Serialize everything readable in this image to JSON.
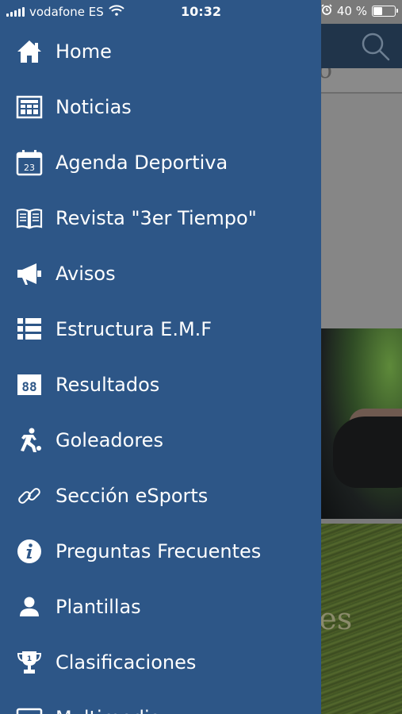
{
  "status_bar": {
    "carrier": "vodafone ES",
    "time": "10:32",
    "battery_percent_text": "40 %",
    "battery_level": 0.4,
    "icons": [
      "signal-icon",
      "wifi-icon",
      "alarm-icon",
      "battery-icon"
    ]
  },
  "background_app": {
    "header_fragment": "o\"",
    "card_text_fragment": "tes",
    "icons": [
      "search-icon"
    ]
  },
  "drawer": {
    "background_color": "#2d5687",
    "items": [
      {
        "label": "Home",
        "icon": "home-icon"
      },
      {
        "label": "Noticias",
        "icon": "newspaper-icon"
      },
      {
        "label": "Agenda Deportiva",
        "icon": "calendar-icon"
      },
      {
        "label": "Revista \"3er Tiempo\"",
        "icon": "book-icon"
      },
      {
        "label": "Avisos",
        "icon": "megaphone-icon"
      },
      {
        "label": "Estructura E.M.F",
        "icon": "list-icon"
      },
      {
        "label": "Resultados",
        "icon": "scoreboard-icon"
      },
      {
        "label": "Goleadores",
        "icon": "kicker-icon"
      },
      {
        "label": "Sección eSports",
        "icon": "link-icon"
      },
      {
        "label": "Preguntas Frecuentes",
        "icon": "info-icon"
      },
      {
        "label": "Plantillas",
        "icon": "person-icon"
      },
      {
        "label": "Clasificaciones",
        "icon": "trophy-icon"
      },
      {
        "label": "Multimedia",
        "icon": "media-icon"
      }
    ]
  }
}
